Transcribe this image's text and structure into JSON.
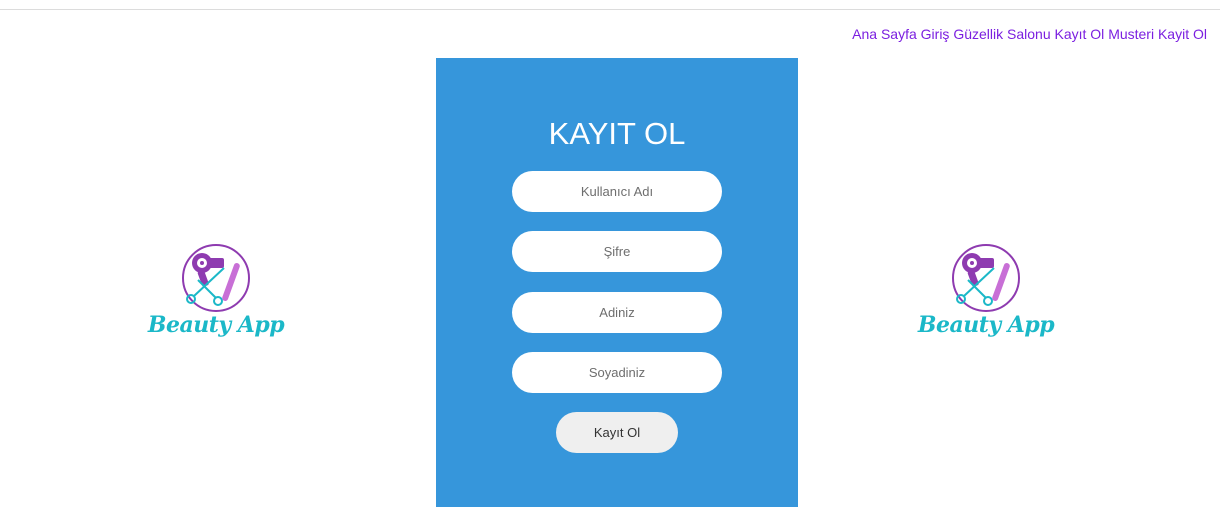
{
  "nav": {
    "items": [
      {
        "label": "Ana Sayfa"
      },
      {
        "label": "Giriş"
      },
      {
        "label": "Güzellik Salonu Kayıt Ol"
      },
      {
        "label": "Musteri Kayit Ol"
      }
    ]
  },
  "logo": {
    "text": "Beauty App",
    "icons": [
      "hair-dryer-icon",
      "scissors-icon",
      "comb-icon"
    ],
    "colors": {
      "circle": "#8e3bb0",
      "text": "#1bb8c8",
      "dryer": "#8e3bb0",
      "scissors": "#1bb8c8",
      "comb": "#c86fd6"
    }
  },
  "form": {
    "title": "KAYIT OL",
    "username_placeholder": "Kullanıcı Adı",
    "password_placeholder": "Şifre",
    "name_placeholder": "Adiniz",
    "surname_placeholder": "Soyadiniz",
    "submit_label": "Kayıt Ol"
  },
  "colors": {
    "panel": "#3696db",
    "nav_link": "#7b1fe0",
    "button": "#efefef"
  }
}
